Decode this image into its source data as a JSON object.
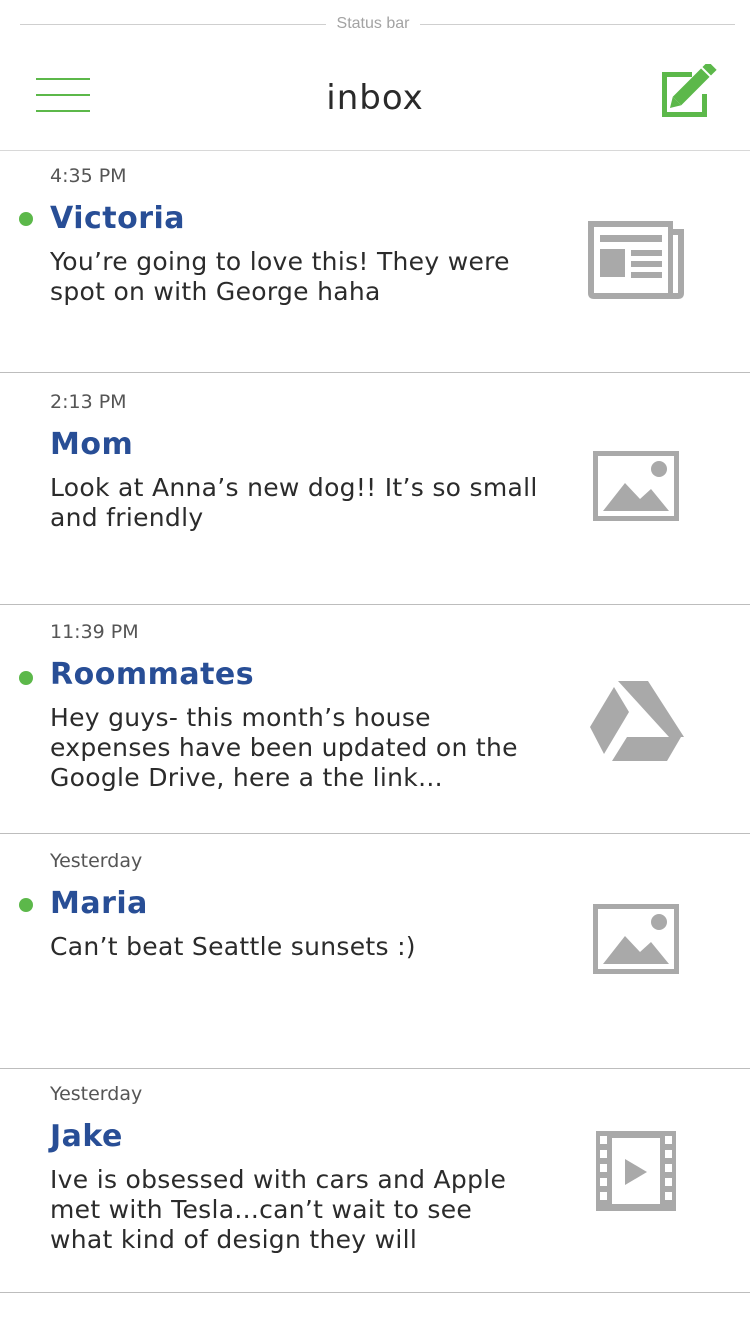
{
  "status_bar": {
    "label": "Status bar"
  },
  "header": {
    "title": "inbox",
    "menu_icon": "hamburger-menu-icon",
    "compose_icon": "compose-edit-icon",
    "accent_color": "#5cb84a"
  },
  "colors": {
    "sender": "#284e96",
    "unread_dot": "#5cb84a",
    "thumbnail": "#a9a9a9",
    "divider": "#bdbdbd"
  },
  "messages": [
    {
      "time": "4:35 PM",
      "sender": "Victoria",
      "unread": true,
      "preview": "You’re going to love this! They were spot on with George haha",
      "attachment_icon": "news-article-icon"
    },
    {
      "time": "2:13 PM",
      "sender": "Mom",
      "unread": false,
      "preview": "Look at Anna’s new dog!! It’s so small and friendly",
      "attachment_icon": "image-icon"
    },
    {
      "time": "11:39 PM",
      "sender": "Roommates",
      "unread": true,
      "preview": "Hey guys- this month’s house expenses have been updated on the Google Drive, here a the link...",
      "attachment_icon": "google-drive-icon"
    },
    {
      "time": "Yesterday",
      "sender": "Maria",
      "unread": true,
      "preview": "Can’t beat Seattle sunsets :)",
      "attachment_icon": "image-icon"
    },
    {
      "time": "Yesterday",
      "sender": "Jake",
      "unread": false,
      "preview": "Ive is obsessed with cars and Apple met with Tesla...can’t wait to see what kind of design they will",
      "attachment_icon": "video-icon"
    }
  ]
}
